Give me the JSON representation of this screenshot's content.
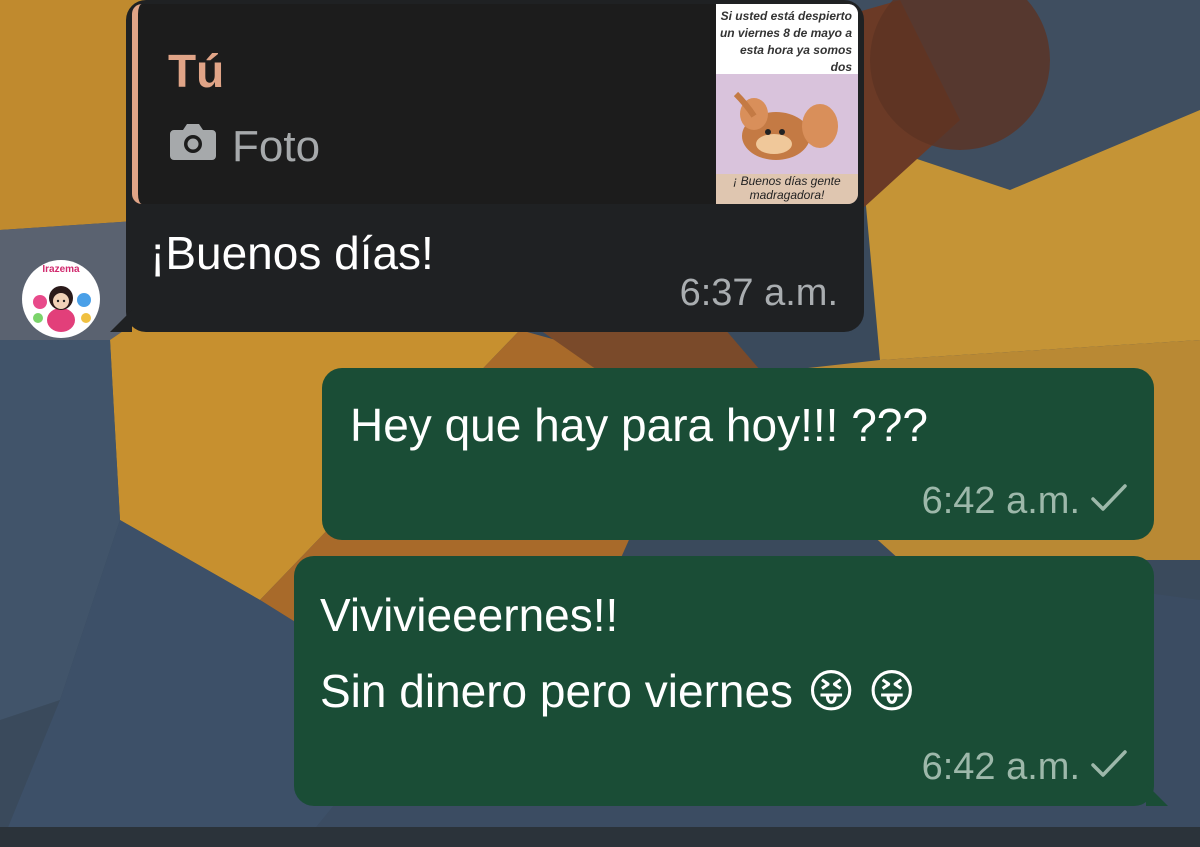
{
  "chat": {
    "messages": [
      {
        "direction": "incoming",
        "quote": {
          "sender": "Tú",
          "type_label": "Foto",
          "type_icon": "camera-icon",
          "thumbnail": {
            "top_text": "Si usted está despierto un viernes 8 de mayo a esta hora ya somos dos",
            "bottom_text": "¡ Buenos días gente madragadora!"
          }
        },
        "text": "¡Buenos días!",
        "time": "6:37 a.m."
      },
      {
        "direction": "outgoing",
        "text": "Hey que hay para hoy!!! ???",
        "time": "6:42 a.m.",
        "status_icon": "single-check-icon"
      },
      {
        "direction": "outgoing",
        "text_line1": "Vivivieeernes!!",
        "text_line2": "Sin dinero pero viernes",
        "emoji": "😝 😝",
        "time": "6:42 a.m.",
        "status_icon": "single-check-icon"
      }
    ],
    "avatar": {
      "label": "Irazema"
    }
  },
  "colors": {
    "incoming_bubble": "#1f2123",
    "outgoing_bubble": "#1a4d36",
    "quote_accent": "#e0a487",
    "timestamp": "#a9adb0"
  }
}
